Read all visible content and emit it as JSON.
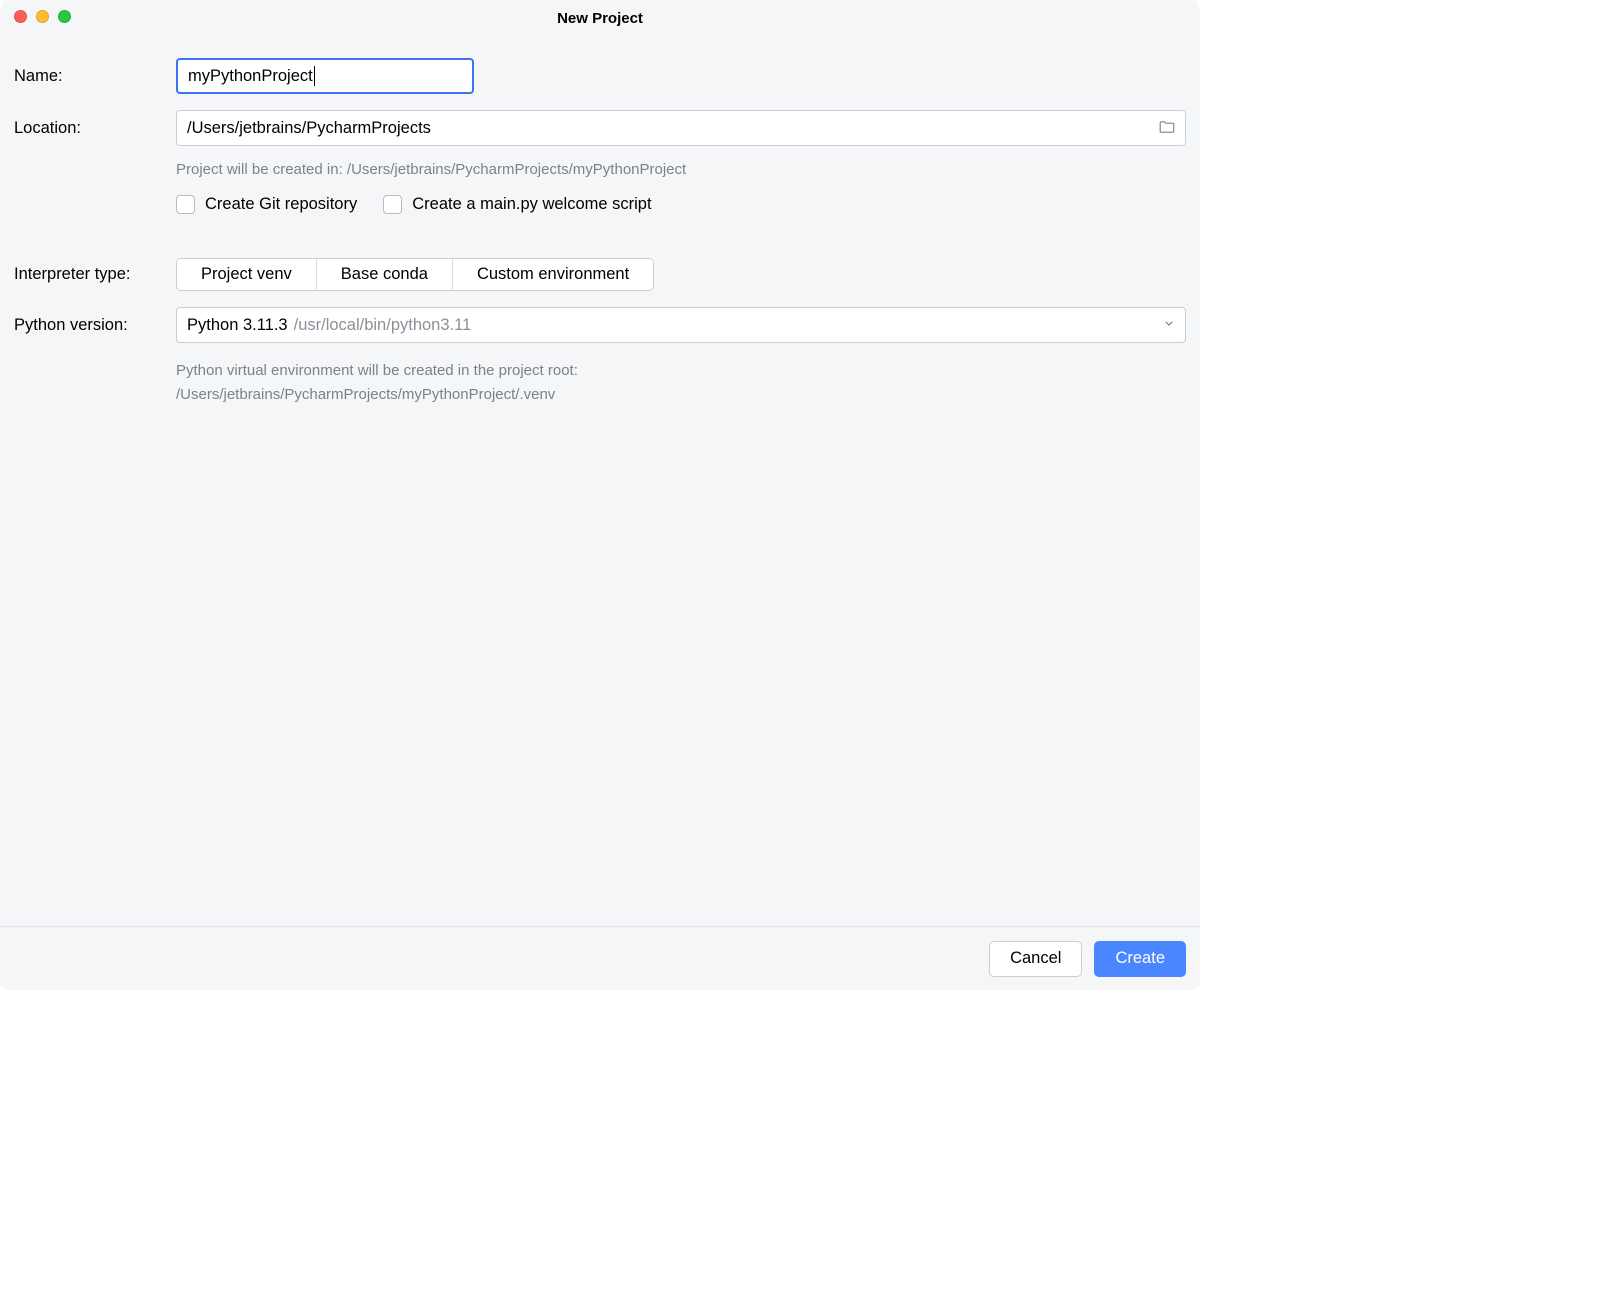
{
  "window": {
    "title": "New Project"
  },
  "form": {
    "name_label": "Name:",
    "name_value": "myPythonProject",
    "location_label": "Location:",
    "location_value": "/Users/jetbrains/PycharmProjects",
    "created_in_hint": "Project will be created in: /Users/jetbrains/PycharmProjects/myPythonProject",
    "git_label": "Create Git repository",
    "welcome_label": "Create a main.py welcome script",
    "interp_label": "Interpreter type:",
    "interp_options": {
      "venv": "Project venv",
      "conda": "Base conda",
      "custom": "Custom environment"
    },
    "pyver_label": "Python version:",
    "pyver_name": "Python 3.11.3",
    "pyver_path": "/usr/local/bin/python3.11",
    "venv_hint_line1": "Python virtual environment will be created in the project root:",
    "venv_hint_line2": "/Users/jetbrains/PycharmProjects/myPythonProject/.venv"
  },
  "footer": {
    "cancel": "Cancel",
    "create": "Create"
  }
}
